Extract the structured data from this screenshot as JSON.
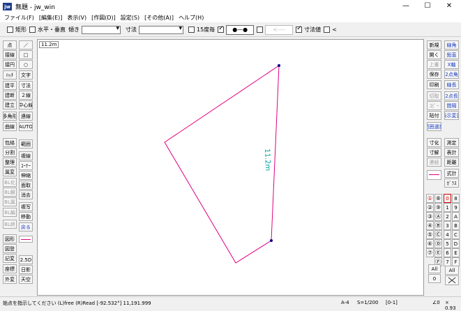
{
  "window": {
    "title": "無題 - jw_win",
    "app_icon": "jw",
    "minimize": "—",
    "maximize": "☐",
    "close": "✕"
  },
  "menu": [
    "ファイル(F)",
    "[編集(E)]",
    "表示(V)",
    "[作図(D)]",
    "設定(S)",
    "[その他(A)]",
    "ヘルプ(H)"
  ],
  "toolbar": {
    "rect": "矩形",
    "horizontal": "水平・垂直",
    "slope": "傾き",
    "dimension": "寸法",
    "deg15": "15度毎",
    "dim_value": "寸法値",
    "lt": "<",
    "slope_value": "",
    "dimension_value": "",
    "line_pattern": "●—●",
    "line_pattern_disabled": "<----"
  },
  "canvas": {
    "scale": "11.2m",
    "dimension_label": "11.2m",
    "line_color": "#e0007f",
    "dim_text_color": "#00a0a0",
    "point_color": "#00008b"
  },
  "left_top_buttons": [
    "点",
    "接線",
    "接円",
    "ﾊｯﾁ",
    "建平",
    "建断",
    "建立",
    "多角形",
    "曲線"
  ],
  "left_top_buttons_right": [
    "／",
    "□",
    "○",
    "文字",
    "寸法",
    "２線",
    "中心線",
    "連線",
    "AUTO"
  ],
  "left_mid_buttons": [
    "包絡",
    "分割",
    "整理",
    "属変",
    "BL化",
    "BL解",
    "BL属",
    "BL編",
    "BL終"
  ],
  "left_mid_buttons_right": [
    "範囲",
    "複線",
    "ｺｰﾅｰ",
    "伸縮",
    "面取",
    "消去",
    "複写",
    "移動",
    "戻る"
  ],
  "left_bottom_buttons": [
    "図形",
    "図登",
    "記変",
    "座標",
    "外変"
  ],
  "left_bottom_buttons_right": [
    "2.5D",
    "日影",
    "天空"
  ],
  "right_col1": [
    "新規",
    "開く",
    "上書",
    "保存",
    "印刷",
    "切取",
    "ｺﾋﾟｰ",
    "貼付",
    "範囲選択"
  ],
  "right_col2": [
    "線角",
    "鉛直",
    "X軸",
    "2点角",
    "線長",
    "2点長",
    "間隔",
    "表示変更"
  ],
  "right_col1b": [
    "寸化",
    "寸解",
    "連続"
  ],
  "right_col2b": [
    "測定",
    "表計",
    "距離",
    "式計",
    "ｶﾞﾗｽ"
  ],
  "layer_numbers": [
    "0",
    "1",
    "2",
    "3",
    "4",
    "5",
    "6",
    "7"
  ],
  "layer_letters": [
    "8",
    "9",
    "A",
    "B",
    "C",
    "D",
    "E",
    "F"
  ],
  "layer_circles": [
    "⑧",
    "⑨",
    "Ⓐ",
    "Ⓑ",
    "Ⓒ",
    "Ⓓ",
    "Ⓔ",
    "Ⓕ"
  ],
  "layer_circles_left": [
    "①",
    "②",
    "③",
    "④",
    "⑤",
    "⑥",
    "⑦"
  ],
  "layer_all": "All",
  "layer_zero": "0",
  "status": {
    "message": "始点を指示してください (L)free (R)Read  [-92.532°] 11,191.999",
    "paper": "A-4",
    "scale": "S=1/200",
    "layer": "[0-1]",
    "angle": "∠0",
    "zoom": "× 0.93"
  }
}
